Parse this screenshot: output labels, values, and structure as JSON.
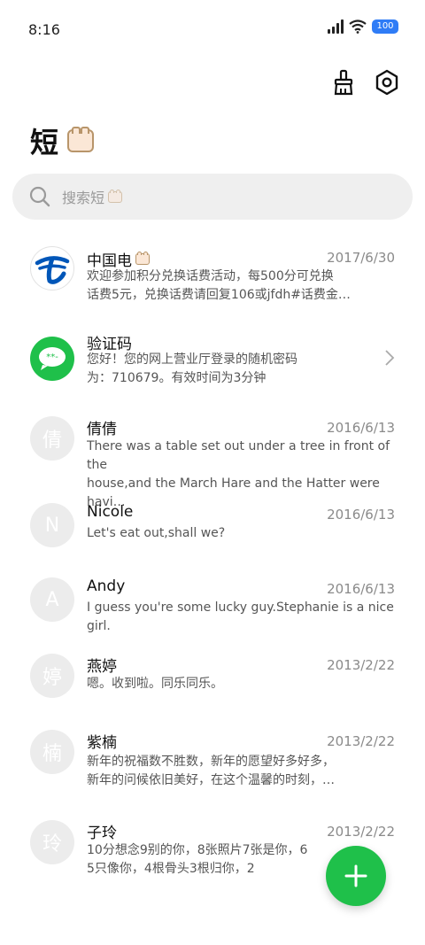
{
  "status_bar": {
    "time": "8:16",
    "battery": "100"
  },
  "header": {
    "title": "短"
  },
  "search": {
    "placeholder": "搜索短"
  },
  "messages": [
    {
      "name": "中国电",
      "date": "2017/6/30",
      "line1": "欢迎参加积分兑换话费活动，每500分可兑换",
      "line2": "话费5元，兑换话费请回复106或jfdh#话费金…",
      "avatar": "telecom-logo"
    },
    {
      "name": "验证码",
      "date": "",
      "line1": "您好！您的网上营业厅登录的随机密码",
      "line2": "为：710679。有效时间为3分钟",
      "avatar": "message-bubble"
    },
    {
      "name": "倩倩",
      "date": "2016/6/13",
      "line1": "There was a table set out under a tree in front of the",
      "line2": "house,and the March Hare and the Hatter were havi…",
      "avatar": "倩"
    },
    {
      "name": "Nicole",
      "date": "2016/6/13",
      "line1": "Let's eat out,shall we?",
      "line2": "",
      "avatar": "N"
    },
    {
      "name": "Andy",
      "date": "2016/6/13",
      "line1": "I guess you're some lucky guy.Stephanie is a nice girl.",
      "line2": "",
      "avatar": "A"
    },
    {
      "name": "燕婷",
      "date": "2013/2/22",
      "line1": "嗯。收到啦。同乐同乐。",
      "line2": "",
      "avatar": "婷"
    },
    {
      "name": "紫楠",
      "date": "2013/2/22",
      "line1": "新年的祝福数不胜数，新年的愿望好多好多，",
      "line2": "新年的问候依旧美好，在这个温馨的时刻，…",
      "avatar": "楠"
    },
    {
      "name": "子玲",
      "date": "2013/2/22",
      "line1": "10分想念9别的你，8张照片7张是你，6",
      "line2": "5只像你，4根骨头3根归你，2",
      "avatar": "玲"
    }
  ],
  "colors": {
    "accent": "#1fc04a",
    "telecom_blue": "#0056b8",
    "avatar_gray": "#ececec"
  }
}
